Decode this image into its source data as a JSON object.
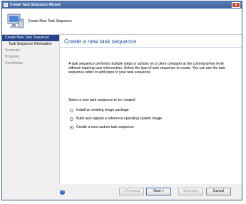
{
  "window": {
    "title": "Create Task Sequence Wizard"
  },
  "header": {
    "title": "Create New Task Sequence"
  },
  "sidebar": {
    "items": [
      {
        "label": "Create New Task Sequence"
      },
      {
        "label": "Task Sequence Information"
      },
      {
        "label": "Summary"
      },
      {
        "label": "Progress"
      },
      {
        "label": "Completion"
      }
    ]
  },
  "main": {
    "title": "Create a new task sequence",
    "description": "A task sequence performs multiple steps or actions on a client computer at the command-line level without requiring user intervention. Select the type of task sequence to create. You can use the task sequence editor to add steps to your task sequence.",
    "prompt": "Select a new task sequence to be created.",
    "options": [
      {
        "label": "Install an existing image package",
        "checked": false
      },
      {
        "label": "Build and capture a reference operating system image",
        "checked": false
      },
      {
        "label": "Create a new custom task sequence",
        "checked": true
      }
    ]
  },
  "buttons": {
    "previous": "< Previous",
    "next": "Next >",
    "summary": "Summary",
    "cancel": "Cancel"
  },
  "help_icon": "?"
}
